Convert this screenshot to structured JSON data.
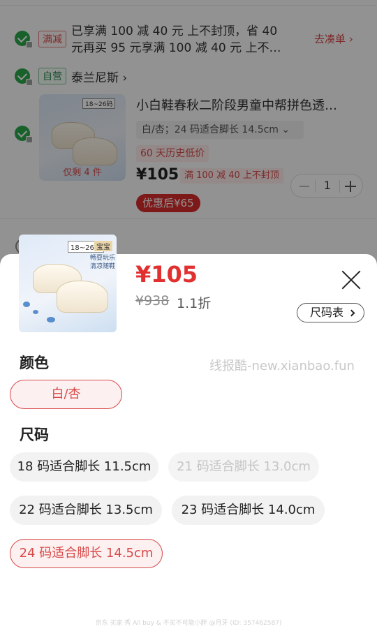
{
  "background": {
    "promo": {
      "tag": "满减",
      "lines": [
        "已享满 100 减 40 元 上不封顶，省 40",
        "元再买 95 元享满 100 减 40 元 上不…"
      ],
      "link": "去凑单"
    },
    "shop": {
      "tag": "自营",
      "name": "泰兰尼斯"
    },
    "product": {
      "thumb_label": "18~26码",
      "stock": "仅剩 4 件",
      "title": "小白鞋春秋二阶段男童中帮拼色透…",
      "variant": "白/杏；24 码适合脚长 14.5cm",
      "history_tag": "60 天历史低价",
      "price": "¥105",
      "price_note": "满 100 减 40 上不封顶",
      "quantity": "1",
      "after_discount": "优惠后¥65"
    }
  },
  "sheet": {
    "thumb_labels": [
      "18~26码",
      "宝宝"
    ],
    "thumb_slogan": "畅耍玩乐 清凉随鞋",
    "price": "¥105",
    "original_price": "¥938",
    "discount_rate": "1.1折",
    "size_chart_label": "尺码表",
    "color_section_title": "颜色",
    "colors": [
      {
        "label": "白/杏",
        "selected": true
      }
    ],
    "size_section_title": "尺码",
    "sizes": [
      {
        "label": "18 码适合脚长 11.5cm",
        "state": "normal"
      },
      {
        "label": "21 码适合脚长 13.0cm",
        "state": "disabled"
      },
      {
        "label": "22 码适合脚长 13.5cm",
        "state": "normal"
      },
      {
        "label": "23 码适合脚长 14.0cm",
        "state": "normal"
      },
      {
        "label": "24 码适合脚长 14.5cm",
        "state": "selected"
      }
    ]
  },
  "watermark": "线报酷-new.xianbao.fun",
  "footer_note": "京东 买家 秀 All buy & 不买不可能小胖 @月牙 (ID: 357462587)",
  "colors": {
    "accent_red": "#e0302f",
    "selected_border": "#d84a4a",
    "check_green": "#2aa84a"
  }
}
